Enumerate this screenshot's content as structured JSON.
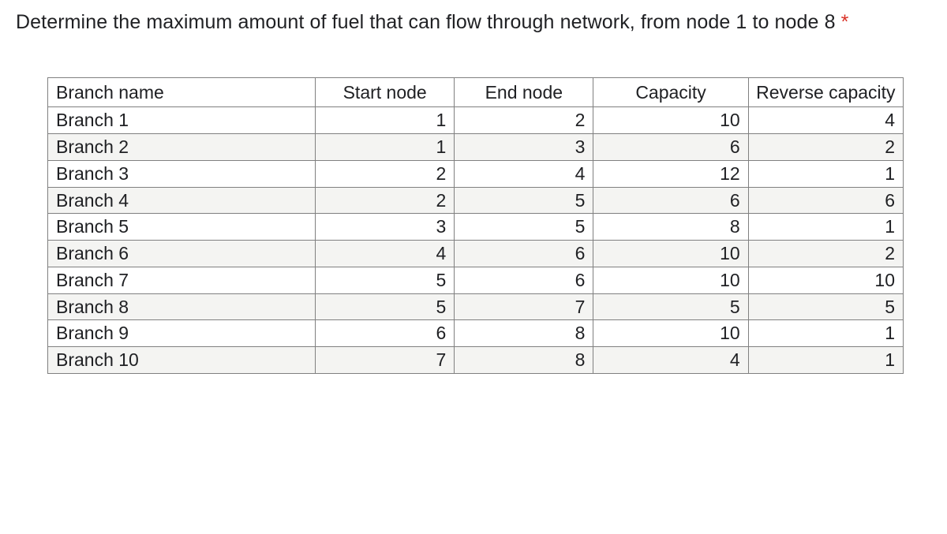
{
  "question": {
    "text": "Determine the maximum amount of fuel that can flow through network, from node 1 to node 8",
    "required_marker": "*"
  },
  "table": {
    "headers": {
      "name": "Branch name",
      "start": "Start node",
      "end": "End node",
      "capacity": "Capacity",
      "reverse": "Reverse capacity"
    },
    "rows": [
      {
        "name": "Branch 1",
        "start": 1,
        "end": 2,
        "capacity": 10,
        "reverse": 4
      },
      {
        "name": "Branch 2",
        "start": 1,
        "end": 3,
        "capacity": 6,
        "reverse": 2
      },
      {
        "name": "Branch 3",
        "start": 2,
        "end": 4,
        "capacity": 12,
        "reverse": 1
      },
      {
        "name": "Branch 4",
        "start": 2,
        "end": 5,
        "capacity": 6,
        "reverse": 6
      },
      {
        "name": "Branch 5",
        "start": 3,
        "end": 5,
        "capacity": 8,
        "reverse": 1
      },
      {
        "name": "Branch 6",
        "start": 4,
        "end": 6,
        "capacity": 10,
        "reverse": 2
      },
      {
        "name": "Branch 7",
        "start": 5,
        "end": 6,
        "capacity": 10,
        "reverse": 10
      },
      {
        "name": "Branch 8",
        "start": 5,
        "end": 7,
        "capacity": 5,
        "reverse": 5
      },
      {
        "name": "Branch 9",
        "start": 6,
        "end": 8,
        "capacity": 10,
        "reverse": 1
      },
      {
        "name": "Branch 10",
        "start": 7,
        "end": 8,
        "capacity": 4,
        "reverse": 1
      }
    ]
  }
}
